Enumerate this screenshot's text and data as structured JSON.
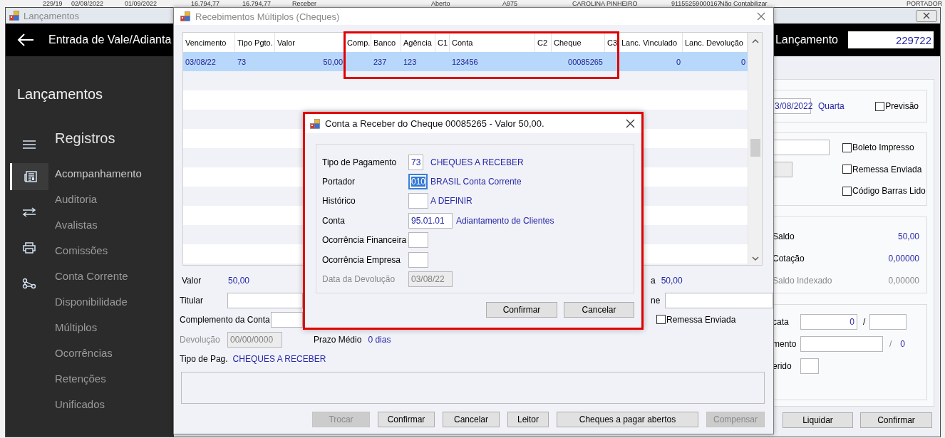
{
  "background_list": {
    "cells": [
      "229/19",
      "02/08/2022",
      "01/09/2022",
      "16.794,77",
      "16.794,77",
      "Receber",
      "Aberto",
      "A975",
      "CAROLINA PINHEIRO",
      "91155259000167",
      "Não Contabilizar",
      "PORTADOR"
    ]
  },
  "main_window": {
    "title": "Lançamentos",
    "header": {
      "title": "Entrada de Vale/Adianta",
      "record_label": "Lançamento",
      "record_value": "229722"
    },
    "sidebar": {
      "heading": "Lançamentos",
      "section": "Registros",
      "items": [
        {
          "label": "Acompanhamento",
          "selected": true
        },
        {
          "label": "Auditoria",
          "selected": false
        },
        {
          "label": "Avalistas",
          "selected": false
        },
        {
          "label": "Comissões",
          "selected": false
        },
        {
          "label": "Conta Corrente",
          "selected": false
        },
        {
          "label": "Disponibilidade",
          "selected": false
        },
        {
          "label": "Múltiplos",
          "selected": false
        },
        {
          "label": "Ocorrências",
          "selected": false
        },
        {
          "label": "Retenções",
          "selected": false
        },
        {
          "label": "Unificados",
          "selected": false
        }
      ]
    },
    "date_group": {
      "date": "3/08/2022",
      "weekday": "Quarta",
      "forecast": {
        "label": "Previsão",
        "checked": false
      }
    },
    "flags_group": {
      "flags": [
        {
          "label": "Boleto Impresso",
          "checked": false
        },
        {
          "label": "Remessa Enviada",
          "checked": false
        },
        {
          "label": "Código Barras Lido",
          "checked": false
        }
      ]
    },
    "balance_group": {
      "rows": [
        {
          "label": "Saldo",
          "value": "50,00",
          "disabled": false
        },
        {
          "label": "Cotação",
          "value": "0,00000",
          "disabled": false
        },
        {
          "label": "Saldo Indexado",
          "value": "0,00000",
          "disabled": true
        }
      ]
    },
    "document_group": {
      "row_1_label": "cata",
      "row_1_value": "0",
      "row_1_separator": "/",
      "row_2_label": "mento",
      "row_2_separator": "/",
      "row_2_count": "0",
      "row_3_label": "erido"
    },
    "buttons": [
      {
        "label": "Liquidar",
        "disabled": false
      },
      {
        "label": "Confirmar",
        "disabled": false
      }
    ]
  },
  "receipts_window": {
    "title": "Recebimentos Múltiplos (Cheques)",
    "table": {
      "columns": [
        "Vencimento",
        "Tipo Pgto.",
        "Valor",
        "Comp.",
        "Banco",
        "Agência",
        "C1",
        "Conta",
        "C2",
        "Cheque",
        "C3",
        "Lanc. Vinculado",
        "Lanc. Devolução"
      ],
      "rows": [
        {
          "selected": true,
          "cells": [
            "03/08/22",
            "73",
            "50,00",
            null,
            "237",
            "123",
            null,
            "123456",
            null,
            "00085265",
            null,
            "0",
            "0"
          ]
        }
      ]
    },
    "form": {
      "value_label": "Valor",
      "value": "50,00",
      "right_label": "a",
      "right_value": "50,00",
      "holder_label": "Titular",
      "right_field_label": "ne",
      "complement_label": "Complemento da Conta",
      "checkboxes": [
        {
          "kind": "covered"
        },
        {
          "kind": "covered"
        },
        {
          "kind": "covered"
        },
        {
          "kind": "checkbox",
          "label": "Remessa Enviada",
          "checked": false
        }
      ],
      "return_label": "Devolução",
      "return_value": "00/00/0000",
      "return_disabled": true,
      "term_label": "Prazo Médio",
      "term_value": "0 dias",
      "payment_label": "Tipo de Pag.",
      "payment_value": "CHEQUES A RECEBER"
    },
    "buttons": [
      {
        "label": "Trocar",
        "disabled": true
      },
      {
        "label": "Confirmar",
        "disabled": false
      },
      {
        "label": "Cancelar",
        "disabled": false
      },
      {
        "label": "Leitor",
        "disabled": false
      },
      {
        "label": "Cheques a pagar abertos",
        "disabled": false
      },
      {
        "label": "Compensar",
        "disabled": true
      }
    ]
  },
  "cheque_dialog": {
    "title": "Conta a Receber do Cheque 00085265 - Valor 50,00.",
    "fields": [
      {
        "label": "Tipo de Pagamento",
        "value": "73",
        "description": "CHEQUES A RECEBER",
        "focused": false,
        "disabled": false
      },
      {
        "label": "Portador",
        "value": "010",
        "description": "BRASIL Conta Corrente",
        "focused": true,
        "disabled": false
      },
      {
        "label": "Histórico",
        "description": "A DEFINIR",
        "focused": false,
        "disabled": false
      },
      {
        "label": "Conta",
        "value": "95.01.01",
        "description": "Adiantamento de Clientes",
        "focused": false,
        "disabled": false
      },
      {
        "label": "Ocorrência Financeira",
        "focused": false,
        "disabled": false
      },
      {
        "label": "Ocorrência Empresa",
        "focused": false,
        "disabled": false
      },
      {
        "label": "Data da Devolução",
        "value": "03/08/22",
        "focused": false,
        "disabled": true
      }
    ],
    "buttons": [
      {
        "label": "Confirmar",
        "disabled": false
      },
      {
        "label": "Cancelar",
        "disabled": false
      }
    ]
  }
}
